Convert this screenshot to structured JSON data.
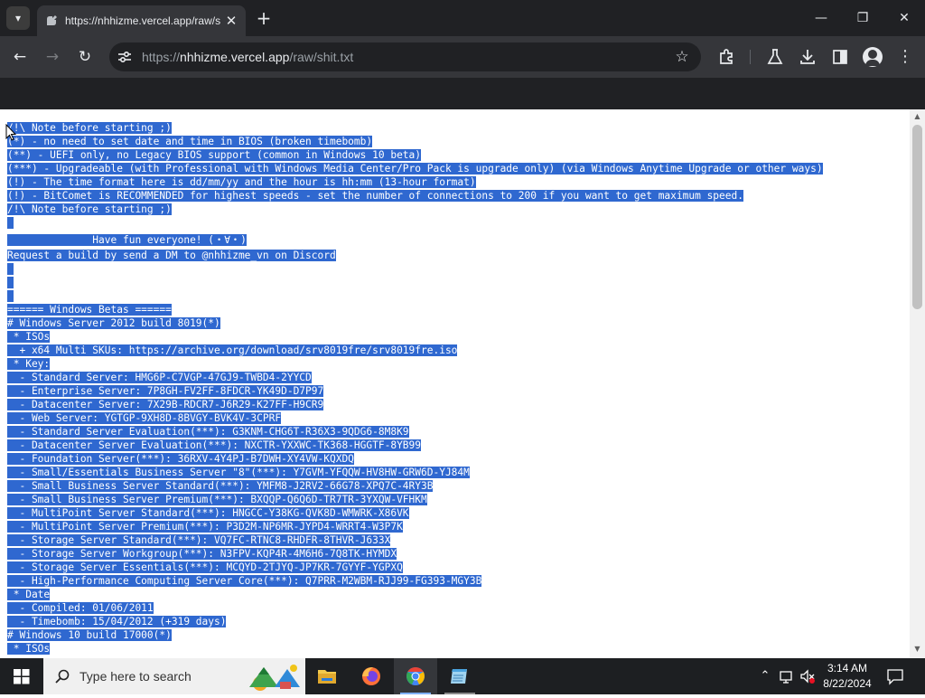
{
  "browser": {
    "tab_title": "https://nhhizme.vercel.app/raw/shit.txt",
    "tab_close": "✕",
    "new_tab": "+",
    "url_scheme": "https://",
    "url_host": "nhhizme.vercel.app",
    "url_path": "/raw/shit.txt",
    "window_controls": {
      "minimize": "—",
      "maximize": "❐",
      "close": "✕"
    },
    "nav": {
      "back": "←",
      "forward": "→",
      "reload": "↻"
    },
    "icons": [
      "tab-search-icon",
      "site-favicon",
      "site-info-icon",
      "bookmark-star-icon",
      "extensions-icon",
      "labs-icon",
      "downloads-icon",
      "side-panel-icon",
      "profile-icon",
      "menu-icon"
    ]
  },
  "document": {
    "lines": [
      "/!\\ Note before starting ;)",
      "(*) - no need to set date and time in BIOS (broken timebomb)",
      "(**) - UEFI only, no Legacy BIOS support (common in Windows 10 beta)",
      "(***) - Upgradeable (with Professional with Windows Media Center/Pro Pack is upgrade only) (via Windows Anytime Upgrade or other ways)",
      "(!) - The time format here is dd/mm/yy and the hour is hh:mm (13-hour format)",
      "(!) - BitComet is RECOMMENDED for highest speeds - set the number of connections to 200 if you want to get maximum speed.",
      "/!\\ Note before starting ;)",
      "",
      "              Have fun everyone! (・∀・)",
      "Request a build by send a DM to @nhhizme_vn on Discord",
      "",
      "",
      "",
      "====== Windows Betas ======",
      "# Windows Server 2012 build 8019(*)",
      " * ISOs",
      "  + x64 Multi SKUs: https://archive.org/download/srv8019fre/srv8019fre.iso",
      " * Key:",
      "  - Standard Server: HMG6P-C7VGP-47GJ9-TWBD4-2YYCD",
      "  - Enterprise Server: 7P8GH-FV2FF-8FDCR-YK49D-D7P97",
      "  - Datacenter Server: 7X29B-RDCR7-J6R29-K27FF-H9CR9",
      "  - Web Server: YGTGP-9XH8D-8BVGY-BVK4V-3CPRF",
      "  - Standard Server Evaluation(***): G3KNM-CHG6T-R36X3-9QDG6-8M8K9",
      "  - Datacenter Server Evaluation(***): NXCTR-YXXWC-TK368-HGGTF-8YB99",
      "  - Foundation Server(***): 36RXV-4Y4PJ-B7DWH-XY4VW-KQXDQ",
      "  - Small/Essentials Business Server \"8\"(***): Y7GVM-YFQQW-HV8HW-GRW6D-YJ84M",
      "  - Small Business Server Standard(***): YMFM8-J2RV2-66G78-XPQ7C-4RY3B",
      "  - Small Business Server Premium(***): BXQQP-Q6Q6D-TR7TR-3YXQW-VFHKM",
      "  - MultiPoint Server Standard(***): HNGCC-Y38KG-QVK8D-WMWRK-X86VK",
      "  - MultiPoint Server Premium(***): P3D2M-NP6MR-JYPD4-WRRT4-W3P7K",
      "  - Storage Server Standard(***): VQ7FC-RTNC8-RHDFR-8THVR-J633X",
      "  - Storage Server Workgroup(***): N3FPV-KQP4R-4M6H6-7Q8TK-HYMDX",
      "  - Storage Server Essentials(***): MCQYD-2TJYQ-JP7KR-7GYYF-YGPXQ",
      "  - High-Performance Computing Server Core(***): Q7PRR-M2WBM-RJJ99-FG393-MGY3B",
      " * Date",
      "  - Compiled: 01/06/2011",
      "  - Timebomb: 15/04/2012 (+319 days)",
      "# Windows 10 build 17000(*)",
      " * ISOs"
    ]
  },
  "taskbar": {
    "search_placeholder": "Type here to search",
    "apps": [
      "file-explorer",
      "firefox",
      "chrome",
      "notepad"
    ],
    "clock_time": "3:14 AM",
    "clock_date": "8/22/2024"
  }
}
